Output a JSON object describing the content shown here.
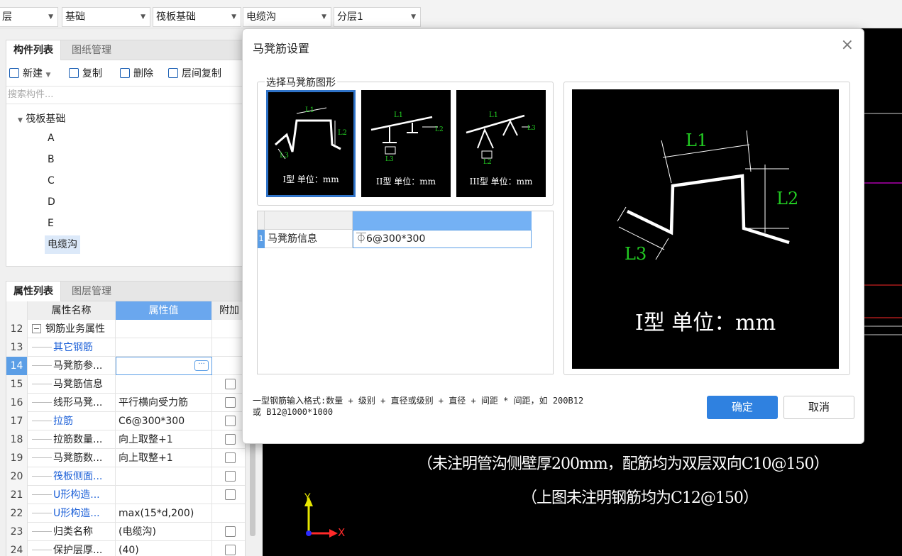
{
  "toolbar": {
    "dropdowns": [
      "层",
      "基础",
      "筏板基础",
      "电缆沟",
      "分层1"
    ]
  },
  "component_panel": {
    "tabs": [
      "构件列表",
      "图纸管理"
    ],
    "actions": [
      "新建",
      "复制",
      "删除",
      "层间复制"
    ],
    "search_placeholder": "搜索构件...",
    "tree_root": "筏板基础",
    "tree_items": [
      "A",
      "B",
      "C",
      "D",
      "E",
      "电缆沟"
    ],
    "selected_item": "电缆沟"
  },
  "property_panel": {
    "tabs": [
      "属性列表",
      "图层管理"
    ],
    "columns": [
      "属性名称",
      "属性值",
      "附加"
    ],
    "rows": [
      {
        "num": "12",
        "name": "钢筋业务属性",
        "value": "",
        "blue": false,
        "check": false,
        "expander": "−"
      },
      {
        "num": "13",
        "name": "其它钢筋",
        "value": "",
        "blue": true,
        "check": false
      },
      {
        "num": "14",
        "name": "马凳筋参...",
        "value": "",
        "blue": false,
        "check": false,
        "current": true
      },
      {
        "num": "15",
        "name": "马凳筋信息",
        "value": "",
        "blue": false,
        "check": true
      },
      {
        "num": "16",
        "name": "线形马凳...",
        "value": "平行横向受力筋",
        "blue": false,
        "check": true
      },
      {
        "num": "17",
        "name": "拉筋",
        "value": "C6@300*300",
        "blue": true,
        "check": true
      },
      {
        "num": "18",
        "name": "拉筋数量...",
        "value": "向上取整+1",
        "blue": false,
        "check": true
      },
      {
        "num": "19",
        "name": "马凳筋数...",
        "value": "向上取整+1",
        "blue": false,
        "check": true
      },
      {
        "num": "20",
        "name": "筏板侧面...",
        "value": "",
        "blue": true,
        "check": true
      },
      {
        "num": "21",
        "name": "U形构造...",
        "value": "",
        "blue": true,
        "check": true
      },
      {
        "num": "22",
        "name": "U形构造...",
        "value": "max(15*d,200)",
        "blue": true,
        "check": false
      },
      {
        "num": "23",
        "name": "归类名称",
        "value": "(电缆沟)",
        "blue": false,
        "check": true
      },
      {
        "num": "24",
        "name": "保护层厚...",
        "value": "(40)",
        "blue": false,
        "check": true
      }
    ]
  },
  "canvas": {
    "note1": "（未注明管沟侧壁厚200mm，配筋均为双层双向C10@150）",
    "note2": "（上图未注明钢筋均为C12@150）",
    "axis_y": "Y",
    "axis_x": "X"
  },
  "dialog": {
    "title": "马凳筋设置",
    "close": "×",
    "group_label": "选择马凳筋图形",
    "shapes": [
      {
        "caption": "I型 单位：mm",
        "selected": true
      },
      {
        "caption": "II型 单位：mm",
        "selected": false
      },
      {
        "caption": "III型 单位：mm",
        "selected": false
      }
    ],
    "table": {
      "row_num": "1",
      "label": "马凳筋信息",
      "value": "⏁6@300*300"
    },
    "preview": {
      "caption": "I型 单位：mm",
      "labels": [
        "L1",
        "L2",
        "L3"
      ]
    },
    "hint_line1": "一型钢筋输入格式:数量 + 级别 + 直径或级别 + 直径 + 间距 * 间距，如 200B12",
    "hint_line2": "或 B12@1000*1000",
    "ok": "确定",
    "cancel": "取消"
  },
  "colors": {
    "accent": "#2f81e0",
    "selected_row": "#5b9ee6",
    "link_blue": "#1f62d8",
    "label_green": "#22cc22",
    "axis_yellow": "#e6e600",
    "axis_red": "#ff2a2a",
    "axis_blue": "#2a2aff"
  }
}
